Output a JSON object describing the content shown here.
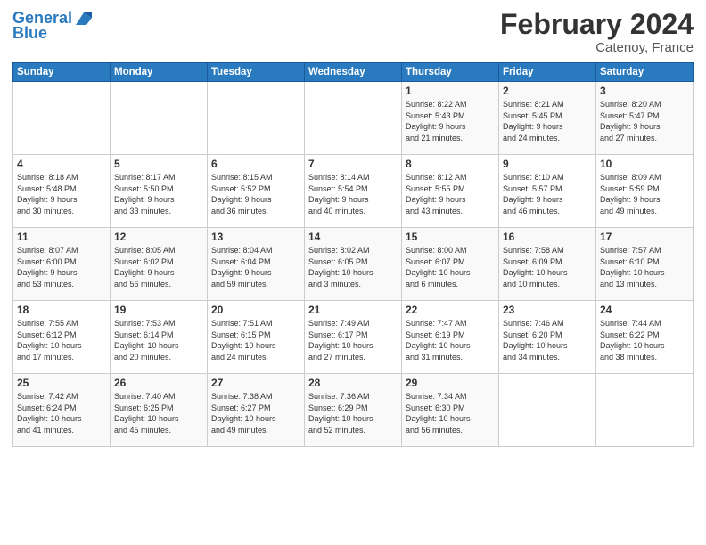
{
  "header": {
    "logo_line1": "General",
    "logo_line2": "Blue",
    "month_year": "February 2024",
    "location": "Catenoy, France"
  },
  "weekdays": [
    "Sunday",
    "Monday",
    "Tuesday",
    "Wednesday",
    "Thursday",
    "Friday",
    "Saturday"
  ],
  "weeks": [
    [
      {
        "day": "",
        "info": ""
      },
      {
        "day": "",
        "info": ""
      },
      {
        "day": "",
        "info": ""
      },
      {
        "day": "",
        "info": ""
      },
      {
        "day": "1",
        "info": "Sunrise: 8:22 AM\nSunset: 5:43 PM\nDaylight: 9 hours\nand 21 minutes."
      },
      {
        "day": "2",
        "info": "Sunrise: 8:21 AM\nSunset: 5:45 PM\nDaylight: 9 hours\nand 24 minutes."
      },
      {
        "day": "3",
        "info": "Sunrise: 8:20 AM\nSunset: 5:47 PM\nDaylight: 9 hours\nand 27 minutes."
      }
    ],
    [
      {
        "day": "4",
        "info": "Sunrise: 8:18 AM\nSunset: 5:48 PM\nDaylight: 9 hours\nand 30 minutes."
      },
      {
        "day": "5",
        "info": "Sunrise: 8:17 AM\nSunset: 5:50 PM\nDaylight: 9 hours\nand 33 minutes."
      },
      {
        "day": "6",
        "info": "Sunrise: 8:15 AM\nSunset: 5:52 PM\nDaylight: 9 hours\nand 36 minutes."
      },
      {
        "day": "7",
        "info": "Sunrise: 8:14 AM\nSunset: 5:54 PM\nDaylight: 9 hours\nand 40 minutes."
      },
      {
        "day": "8",
        "info": "Sunrise: 8:12 AM\nSunset: 5:55 PM\nDaylight: 9 hours\nand 43 minutes."
      },
      {
        "day": "9",
        "info": "Sunrise: 8:10 AM\nSunset: 5:57 PM\nDaylight: 9 hours\nand 46 minutes."
      },
      {
        "day": "10",
        "info": "Sunrise: 8:09 AM\nSunset: 5:59 PM\nDaylight: 9 hours\nand 49 minutes."
      }
    ],
    [
      {
        "day": "11",
        "info": "Sunrise: 8:07 AM\nSunset: 6:00 PM\nDaylight: 9 hours\nand 53 minutes."
      },
      {
        "day": "12",
        "info": "Sunrise: 8:05 AM\nSunset: 6:02 PM\nDaylight: 9 hours\nand 56 minutes."
      },
      {
        "day": "13",
        "info": "Sunrise: 8:04 AM\nSunset: 6:04 PM\nDaylight: 9 hours\nand 59 minutes."
      },
      {
        "day": "14",
        "info": "Sunrise: 8:02 AM\nSunset: 6:05 PM\nDaylight: 10 hours\nand 3 minutes."
      },
      {
        "day": "15",
        "info": "Sunrise: 8:00 AM\nSunset: 6:07 PM\nDaylight: 10 hours\nand 6 minutes."
      },
      {
        "day": "16",
        "info": "Sunrise: 7:58 AM\nSunset: 6:09 PM\nDaylight: 10 hours\nand 10 minutes."
      },
      {
        "day": "17",
        "info": "Sunrise: 7:57 AM\nSunset: 6:10 PM\nDaylight: 10 hours\nand 13 minutes."
      }
    ],
    [
      {
        "day": "18",
        "info": "Sunrise: 7:55 AM\nSunset: 6:12 PM\nDaylight: 10 hours\nand 17 minutes."
      },
      {
        "day": "19",
        "info": "Sunrise: 7:53 AM\nSunset: 6:14 PM\nDaylight: 10 hours\nand 20 minutes."
      },
      {
        "day": "20",
        "info": "Sunrise: 7:51 AM\nSunset: 6:15 PM\nDaylight: 10 hours\nand 24 minutes."
      },
      {
        "day": "21",
        "info": "Sunrise: 7:49 AM\nSunset: 6:17 PM\nDaylight: 10 hours\nand 27 minutes."
      },
      {
        "day": "22",
        "info": "Sunrise: 7:47 AM\nSunset: 6:19 PM\nDaylight: 10 hours\nand 31 minutes."
      },
      {
        "day": "23",
        "info": "Sunrise: 7:46 AM\nSunset: 6:20 PM\nDaylight: 10 hours\nand 34 minutes."
      },
      {
        "day": "24",
        "info": "Sunrise: 7:44 AM\nSunset: 6:22 PM\nDaylight: 10 hours\nand 38 minutes."
      }
    ],
    [
      {
        "day": "25",
        "info": "Sunrise: 7:42 AM\nSunset: 6:24 PM\nDaylight: 10 hours\nand 41 minutes."
      },
      {
        "day": "26",
        "info": "Sunrise: 7:40 AM\nSunset: 6:25 PM\nDaylight: 10 hours\nand 45 minutes."
      },
      {
        "day": "27",
        "info": "Sunrise: 7:38 AM\nSunset: 6:27 PM\nDaylight: 10 hours\nand 49 minutes."
      },
      {
        "day": "28",
        "info": "Sunrise: 7:36 AM\nSunset: 6:29 PM\nDaylight: 10 hours\nand 52 minutes."
      },
      {
        "day": "29",
        "info": "Sunrise: 7:34 AM\nSunset: 6:30 PM\nDaylight: 10 hours\nand 56 minutes."
      },
      {
        "day": "",
        "info": ""
      },
      {
        "day": "",
        "info": ""
      }
    ]
  ]
}
